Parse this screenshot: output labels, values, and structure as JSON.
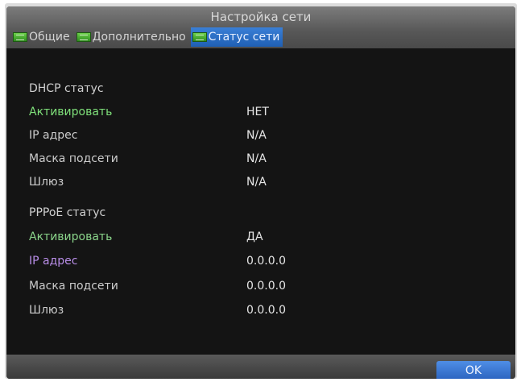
{
  "window": {
    "title": "Настройка сети"
  },
  "tabs": [
    {
      "label": "Общие",
      "icon": "network-card-icon"
    },
    {
      "label": "Дополнительно",
      "icon": "network-card-icon"
    },
    {
      "label": "Статус сети",
      "icon": "network-card-icon",
      "active": true
    }
  ],
  "dhcp": {
    "heading": "DHCP статус",
    "rows": [
      {
        "label": "Активировать",
        "value": "НЕТ"
      },
      {
        "label": "IP адрес",
        "value": "N/A"
      },
      {
        "label": "Маска подсети",
        "value": "N/A"
      },
      {
        "label": "Шлюз",
        "value": "N/A"
      }
    ]
  },
  "pppoe": {
    "heading": "PPPoE статус",
    "rows": [
      {
        "label": "Активировать",
        "value": "ДА"
      },
      {
        "label": "IP адрес",
        "value": "0.0.0.0"
      },
      {
        "label": "Маска подсети",
        "value": "0.0.0.0"
      },
      {
        "label": "Шлюз",
        "value": "0.0.0.0"
      }
    ]
  },
  "footer": {
    "ok_label": "OK"
  },
  "colors": {
    "accent": "#2a62be",
    "background": "#141414",
    "label_green": "#7fe07a",
    "label_violet": "#b98ee8"
  }
}
